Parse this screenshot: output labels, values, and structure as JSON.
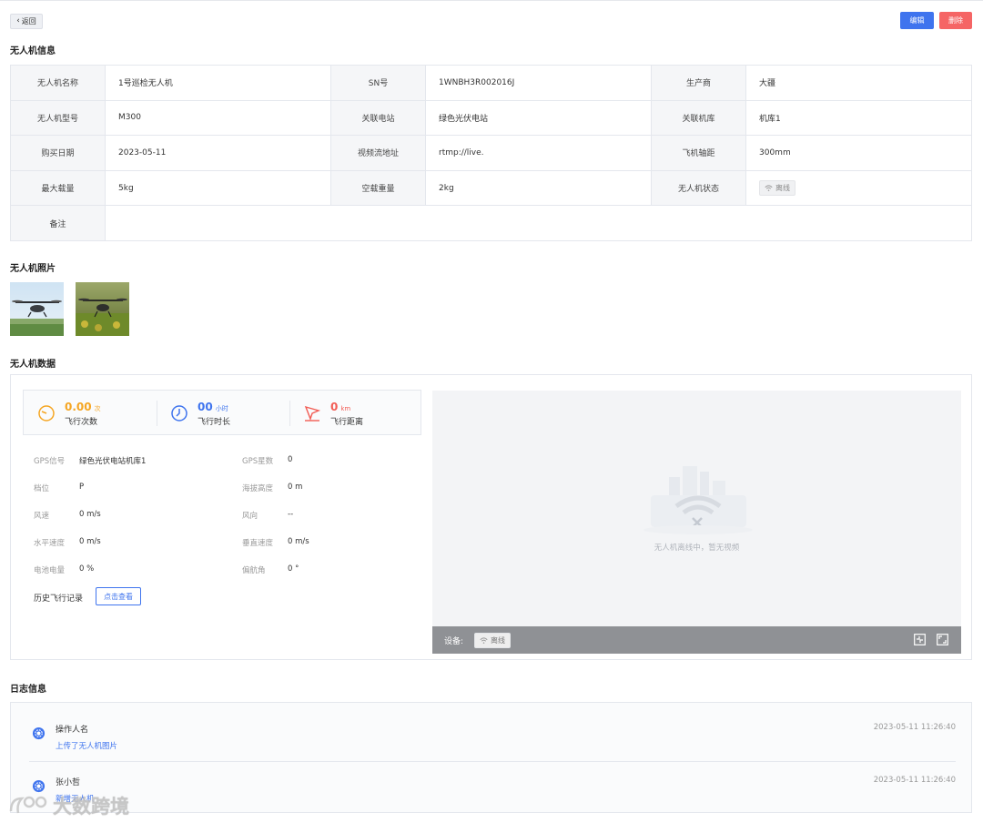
{
  "toolbar": {
    "back_label": "返回",
    "edit_label": "编辑",
    "delete_label": "删除"
  },
  "sections": {
    "info": "无人机信息",
    "photos": "无人机照片",
    "data": "无人机数据",
    "log": "日志信息"
  },
  "info": {
    "rows": [
      [
        {
          "label": "无人机名称",
          "value": "1号巡检无人机"
        },
        {
          "label": "SN号",
          "value": "1WNBH3R002016J"
        },
        {
          "label": "生产商",
          "value": "大疆"
        }
      ],
      [
        {
          "label": "无人机型号",
          "value": "M300"
        },
        {
          "label": "关联电站",
          "value": "绿色光伏电站"
        },
        {
          "label": "关联机库",
          "value": "机库1"
        }
      ],
      [
        {
          "label": "购买日期",
          "value": "2023-05-11"
        },
        {
          "label": "视频流地址",
          "value": "rtmp://live."
        },
        {
          "label": "飞机轴距",
          "value": "300mm"
        }
      ],
      [
        {
          "label": "最大载量",
          "value": "5kg"
        },
        {
          "label": "空载重量",
          "value": "2kg"
        },
        {
          "label": "无人机状态",
          "value": "离线"
        }
      ]
    ],
    "remark": {
      "label": "备注",
      "value": ""
    }
  },
  "stats": [
    {
      "value": "0.00",
      "unit": "次",
      "label": "飞行次数",
      "color": "#f5a623",
      "icon": "speedometer-icon"
    },
    {
      "value": "00",
      "unit": "小时",
      "label": "飞行时长",
      "color": "#3f74ee",
      "icon": "clock-icon"
    },
    {
      "value": "0",
      "unit": "km",
      "label": "飞行距离",
      "color": "#f25c54",
      "icon": "distance-icon"
    }
  ],
  "telemetry": {
    "left": [
      {
        "label": "GPS信号",
        "value": "绿色光伏电站机库1"
      },
      {
        "label": "档位",
        "value": "P"
      },
      {
        "label": "风速",
        "value": "0 m/s"
      },
      {
        "label": "水平速度",
        "value": "0 m/s"
      },
      {
        "label": "电池电量",
        "value": "0 %"
      }
    ],
    "right": [
      {
        "label": "GPS星数",
        "value": "0"
      },
      {
        "label": "海拔高度",
        "value": "0 m"
      },
      {
        "label": "风向",
        "value": "--"
      },
      {
        "label": "垂直速度",
        "value": "0 m/s"
      },
      {
        "label": "偏航角",
        "value": "0 °"
      }
    ]
  },
  "history": {
    "label": "历史飞行记录",
    "button": "点击查看"
  },
  "video": {
    "message": "无人机离线中，暂无视频",
    "device_label": "设备:",
    "device_status": "离线"
  },
  "logs": [
    {
      "operator": "操作人名",
      "action": "上传了无人机图片",
      "time": "2023-05-11  11:26:40"
    },
    {
      "operator": "张小哲",
      "action": "新增无人机",
      "time": "2023-05-11  11:26:40"
    }
  ],
  "watermark": {
    "text": "大数跨境"
  }
}
